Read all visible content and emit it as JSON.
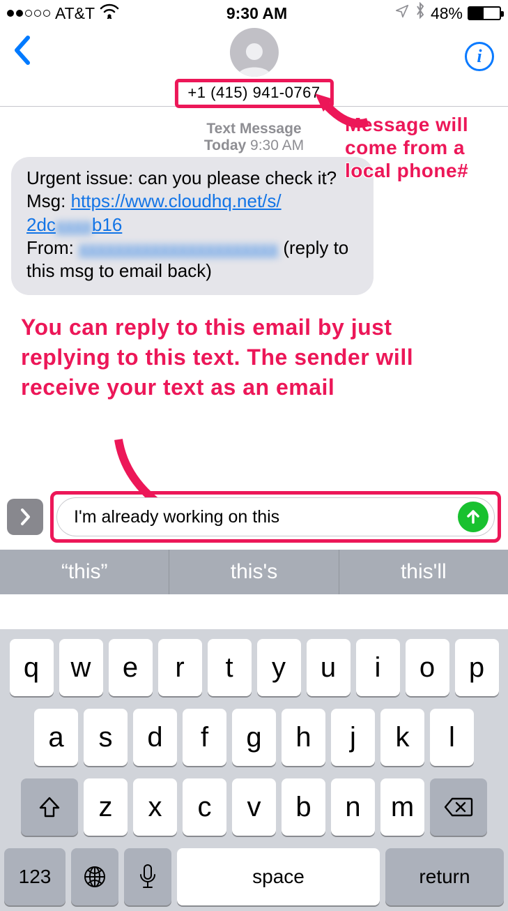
{
  "status": {
    "carrier": "AT&T",
    "time": "9:30 AM",
    "battery_pct": "48%"
  },
  "header": {
    "phone": "+1 (415) 941-0767"
  },
  "thread": {
    "label": "Text Message",
    "day": "Today",
    "time": "9:30 AM"
  },
  "message": {
    "line1": "Urgent issue: can you please check it?",
    "line2_prefix": "Msg: ",
    "url_visible": "https://www.cloudhq.net/s/",
    "url_part2a": "2dc",
    "url_part2_blur": "xxxx",
    "url_part2b": "b16",
    "line3_prefix": "From: ",
    "from_blur": "xxxxxxxxxxxxxxxxxxxxxx",
    "line3_suffix": " (reply to this msg to email back)"
  },
  "annotations": {
    "top": "Message will come from a local phone#",
    "main": "You can reply to this email by just replying to this text. The sender will receive your text as an email"
  },
  "compose": {
    "value": "I'm already working on this"
  },
  "quicktype": {
    "a": "“this”",
    "b": "this's",
    "c": "this'll"
  },
  "keyboard": {
    "row1": [
      "q",
      "w",
      "e",
      "r",
      "t",
      "y",
      "u",
      "i",
      "o",
      "p"
    ],
    "row2": [
      "a",
      "s",
      "d",
      "f",
      "g",
      "h",
      "j",
      "k",
      "l"
    ],
    "row3": [
      "z",
      "x",
      "c",
      "v",
      "b",
      "n",
      "m"
    ],
    "num": "123",
    "space": "space",
    "ret": "return"
  }
}
